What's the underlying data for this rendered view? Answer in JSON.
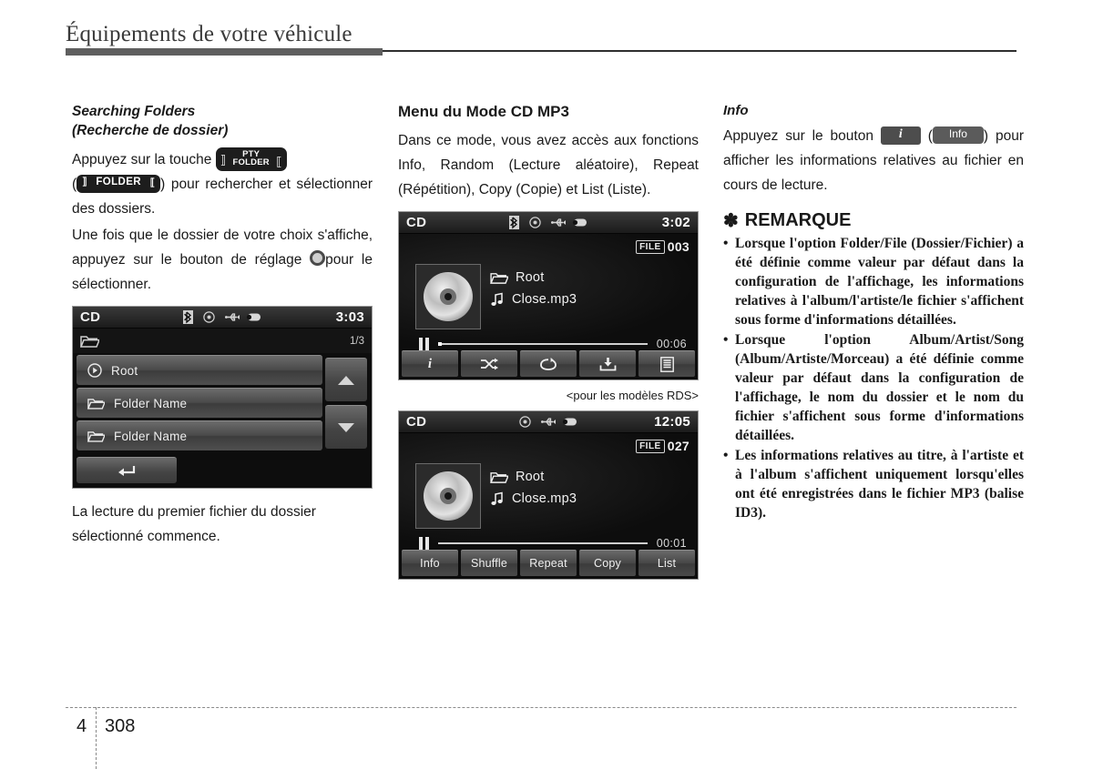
{
  "header": {
    "title": "Équipements de votre véhicule"
  },
  "col1": {
    "heading_line1": "Searching Folders",
    "heading_line2": "(Recherche de dossier)",
    "para1_a": "Appuyez sur la touche",
    "key_pty_top": "PTY",
    "key_pty_bottom": "FOLDER",
    "key_folder_label": "FOLDER",
    "para1_b": ")",
    "para1_c": "pour rechercher et sélectionner des dossiers.",
    "para2_a": "Une fois que le dossier de votre choix s'affiche, appuyez sur le bouton de réglage",
    "para2_b": "pour le sélectionner.",
    "device": {
      "source": "CD",
      "clock": "3:03",
      "page_indicator": "1/3",
      "rows": [
        {
          "icon": "play-circle-icon",
          "label": "Root"
        },
        {
          "icon": "folder-icon",
          "label": "Folder Name"
        },
        {
          "icon": "folder-icon",
          "label": "Folder Name"
        }
      ],
      "scroll_up": "scroll-up-icon",
      "scroll_down": "scroll-down-icon",
      "back": "back-arrow-icon"
    },
    "para3": "La lecture du premier fichier du dossier sélectionné commence."
  },
  "col2": {
    "heading": "Menu du Mode CD MP3",
    "para1": "Dans ce mode, vous avez accès aux fonctions Info, Random (Lecture aléatoire), Repeat (Répétition), Copy (Copie) et List (Liste).",
    "device_rds": {
      "source": "CD",
      "clock": "3:02",
      "file_tag": "FILE",
      "file_number": "003",
      "folder": "Root",
      "file": "Close.mp3",
      "elapsed": "00:06",
      "toolbar": [
        {
          "name": "info-icon",
          "label": "i"
        },
        {
          "name": "shuffle-icon",
          "label": ""
        },
        {
          "name": "repeat-icon",
          "label": ""
        },
        {
          "name": "copy-icon",
          "label": ""
        },
        {
          "name": "list-icon",
          "label": ""
        }
      ]
    },
    "caption": "<pour les modèles RDS>",
    "device_std": {
      "source": "CD",
      "clock": "12:05",
      "file_tag": "FILE",
      "file_number": "027",
      "folder": "Root",
      "file": "Close.mp3",
      "elapsed": "00:01",
      "toolbar": [
        {
          "name": "info-button",
          "label": "Info"
        },
        {
          "name": "shuffle-button",
          "label": "Shuffle"
        },
        {
          "name": "repeat-button",
          "label": "Repeat"
        },
        {
          "name": "copy-button",
          "label": "Copy"
        },
        {
          "name": "list-button",
          "label": "List"
        }
      ]
    }
  },
  "col3": {
    "heading": "Info",
    "para1_a": "Appuyez sur le bouton",
    "key_i_label": "i",
    "key_info_label": "Info",
    "para1_open": "(",
    "para1_close": ")",
    "para1_b": "pour afficher les informations relatives au fichier en cours de lecture.",
    "note_symbol": "✽",
    "note_title": "REMARQUE",
    "notes": [
      "Lorsque l'option Folder/File (Dossier/Fichier) a été définie comme valeur par défaut dans la configuration de l'affichage, les informations relatives à l'album/l'artiste/le fichier s'affichent sous forme d'informations détaillées.",
      "Lorsque l'option Album/Artist/Song (Album/Artiste/Morceau) a été définie comme valeur par défaut dans la configuration de l'affichage, le nom du dossier et le nom du fichier s'affichent sous forme d'informations détaillées.",
      "Les informations relatives au titre, à l'artiste et à l'album s'affichent uniquement lorsqu'elles ont été enregistrées dans le fichier MP3 (balise ID3)."
    ]
  },
  "footer": {
    "chapter": "4",
    "page_number": "308"
  }
}
